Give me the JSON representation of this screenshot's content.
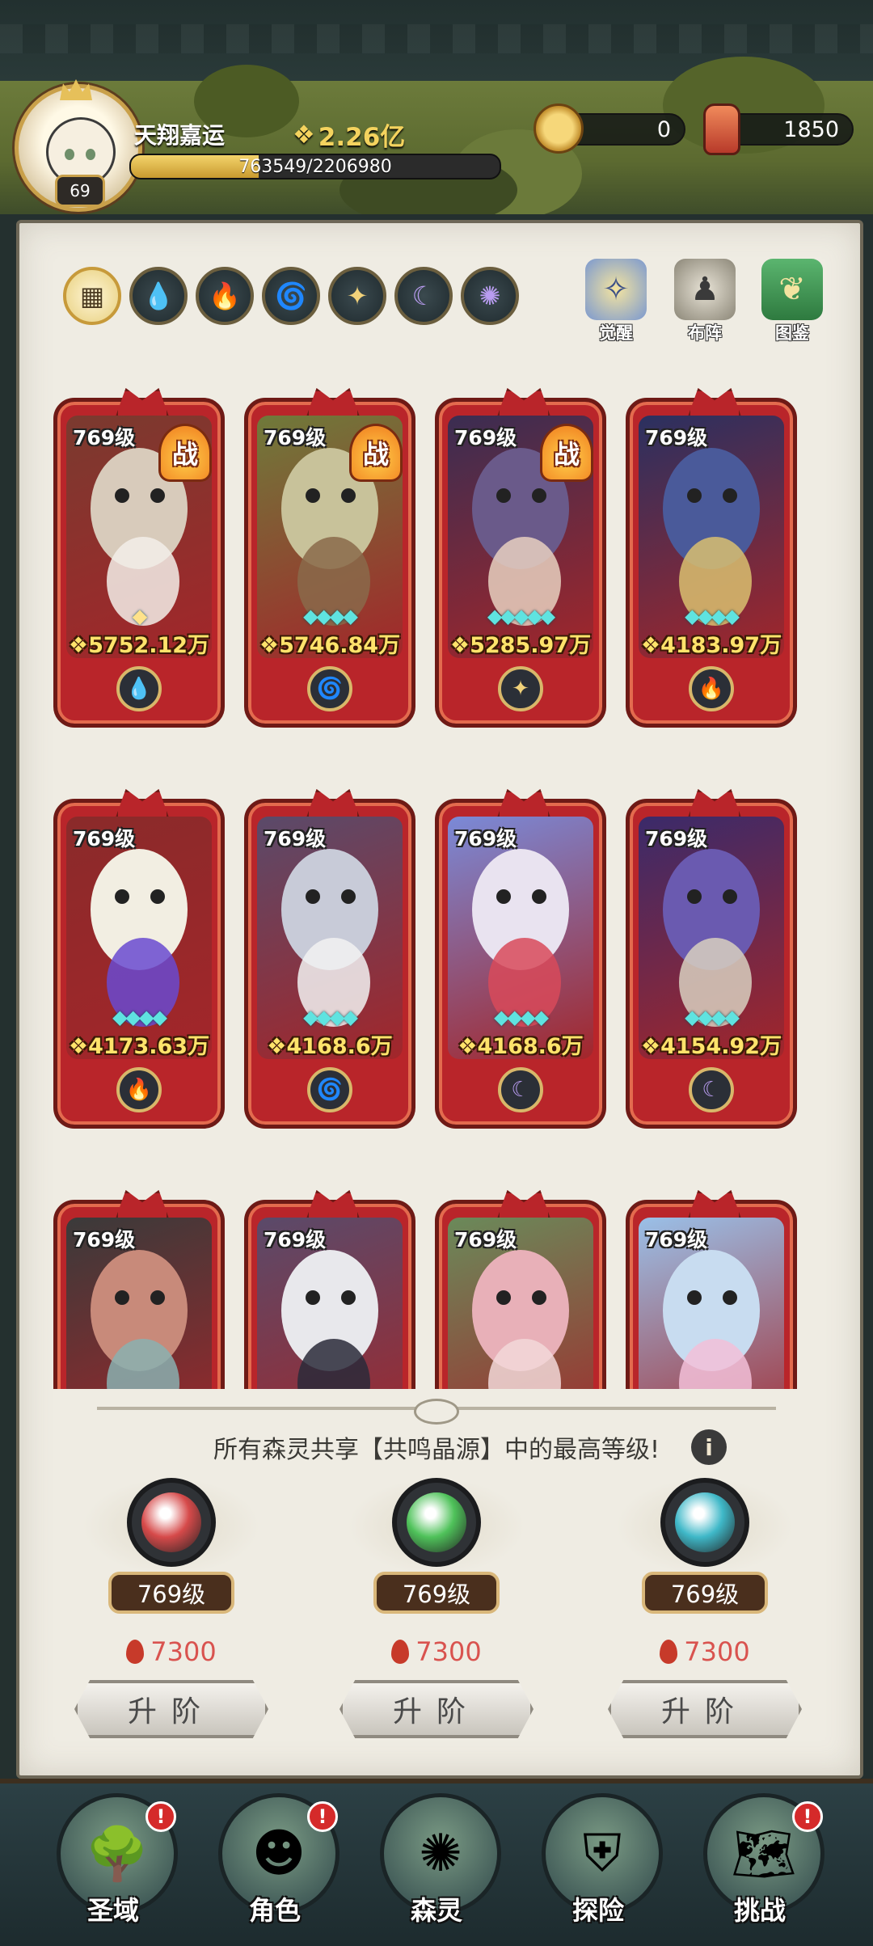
{
  "header": {
    "player_name": "天翔嘉运",
    "player_level": "69",
    "total_power": "2.26亿",
    "exp_text": "763549/2206980",
    "exp_fraction": 0.346,
    "coins": "0",
    "fuel": "1850"
  },
  "filters": [
    {
      "name": "all",
      "icon": "grid-icon"
    },
    {
      "name": "water",
      "icon": "water-drop-icon"
    },
    {
      "name": "fire",
      "icon": "flame-icon"
    },
    {
      "name": "wind",
      "icon": "wind-icon"
    },
    {
      "name": "light",
      "icon": "sun-icon"
    },
    {
      "name": "dark",
      "icon": "moon-icon"
    },
    {
      "name": "void",
      "icon": "swirl-icon"
    }
  ],
  "top_actions": {
    "awaken": "觉醒",
    "formation": "布阵",
    "codex": "图鉴"
  },
  "cards": [
    {
      "level": "769级",
      "power": "5752.12万",
      "in_battle": true,
      "battle_label": "战",
      "stars": 1,
      "star_color": "gold",
      "element": "water",
      "art": [
        "#d8cbbb",
        "#7a3a2f",
        "#f3efe9"
      ]
    },
    {
      "level": "769级",
      "power": "5746.84万",
      "in_battle": true,
      "battle_label": "战",
      "stars": 4,
      "star_color": "cyan",
      "element": "wind",
      "art": [
        "#c8c29a",
        "#6f7a3a",
        "#8a6a4a"
      ]
    },
    {
      "level": "769级",
      "power": "5285.97万",
      "in_battle": true,
      "battle_label": "战",
      "stars": 5,
      "star_color": "cyan",
      "element": "light",
      "art": [
        "#6a5a8a",
        "#3a2d52",
        "#e8d0c0"
      ]
    },
    {
      "level": "769级",
      "power": "4183.97万",
      "in_battle": false,
      "battle_label": "",
      "stars": 4,
      "star_color": "cyan",
      "element": "fire",
      "art": [
        "#4a5a9a",
        "#2a3060",
        "#d9c070"
      ]
    },
    {
      "level": "769级",
      "power": "4173.63万",
      "in_battle": false,
      "battle_label": "",
      "stars": 4,
      "star_color": "cyan",
      "element": "fire",
      "art": [
        "#f2eee2",
        "#8a2a2a",
        "#6a4ad0"
      ]
    },
    {
      "level": "769级",
      "power": "4168.6万",
      "in_battle": false,
      "battle_label": "",
      "stars": 4,
      "star_color": "cyan",
      "element": "wind",
      "art": [
        "#c8cbd8",
        "#5a4a6a",
        "#f2f2f2"
      ]
    },
    {
      "level": "769级",
      "power": "4168.6万",
      "in_battle": false,
      "battle_label": "",
      "stars": 4,
      "star_color": "cyan",
      "element": "dark",
      "art": [
        "#e9e3f0",
        "#7a8ad8",
        "#d84a5a"
      ]
    },
    {
      "level": "769级",
      "power": "4154.92万",
      "in_battle": false,
      "battle_label": "",
      "stars": 4,
      "star_color": "cyan",
      "element": "dark",
      "art": [
        "#6a5ab0",
        "#3a2a6a",
        "#d8d0c0"
      ]
    },
    {
      "level": "769级",
      "power": "",
      "in_battle": false,
      "battle_label": "",
      "stars": 0,
      "star_color": "cyan",
      "element": "",
      "art": [
        "#c88a7a",
        "#3a3a3a",
        "#8ab0b0"
      ]
    },
    {
      "level": "769级",
      "power": "",
      "in_battle": false,
      "battle_label": "",
      "stars": 0,
      "star_color": "cyan",
      "element": "",
      "art": [
        "#e8e8ec",
        "#5a4a6a",
        "#2a2a3a"
      ]
    },
    {
      "level": "769级",
      "power": "",
      "in_battle": false,
      "battle_label": "",
      "stars": 0,
      "star_color": "cyan",
      "element": "",
      "art": [
        "#e8b0b8",
        "#6a8a5a",
        "#f2d8d8"
      ]
    },
    {
      "level": "769级",
      "power": "",
      "in_battle": false,
      "battle_label": "",
      "stars": 0,
      "star_color": "cyan",
      "element": "",
      "art": [
        "#c8dcf0",
        "#9ac0e8",
        "#f2c0d8"
      ]
    }
  ],
  "shared_notice": "所有森灵共享【共鸣晶源】中的最高等级!",
  "info_glyph": "i",
  "crystals": [
    {
      "level": "769级",
      "cost": "7300",
      "button": "升阶",
      "orb_color": "#d64a4a"
    },
    {
      "level": "769级",
      "cost": "7300",
      "button": "升阶",
      "orb_color": "#4fc25a"
    },
    {
      "level": "769级",
      "cost": "7300",
      "button": "升阶",
      "orb_color": "#3fb8c8"
    }
  ],
  "bottom_nav": [
    {
      "label": "圣域",
      "alert": true,
      "icon": "tree-icon"
    },
    {
      "label": "角色",
      "alert": true,
      "icon": "character-icon"
    },
    {
      "label": "森灵",
      "alert": false,
      "icon": "spirit-icon"
    },
    {
      "label": "探险",
      "alert": false,
      "icon": "shield-icon"
    },
    {
      "label": "挑战",
      "alert": true,
      "icon": "map-icon"
    }
  ],
  "alert_glyph": "!",
  "element_colors": {
    "water": "#6fd0f0",
    "fire": "#f05a3a",
    "wind": "#7ae0b0",
    "light": "#f2d27a",
    "dark": "#b99cf0"
  },
  "element_glyphs": {
    "water": "💧",
    "fire": "🔥",
    "wind": "🌀",
    "light": "✦",
    "dark": "☾"
  }
}
